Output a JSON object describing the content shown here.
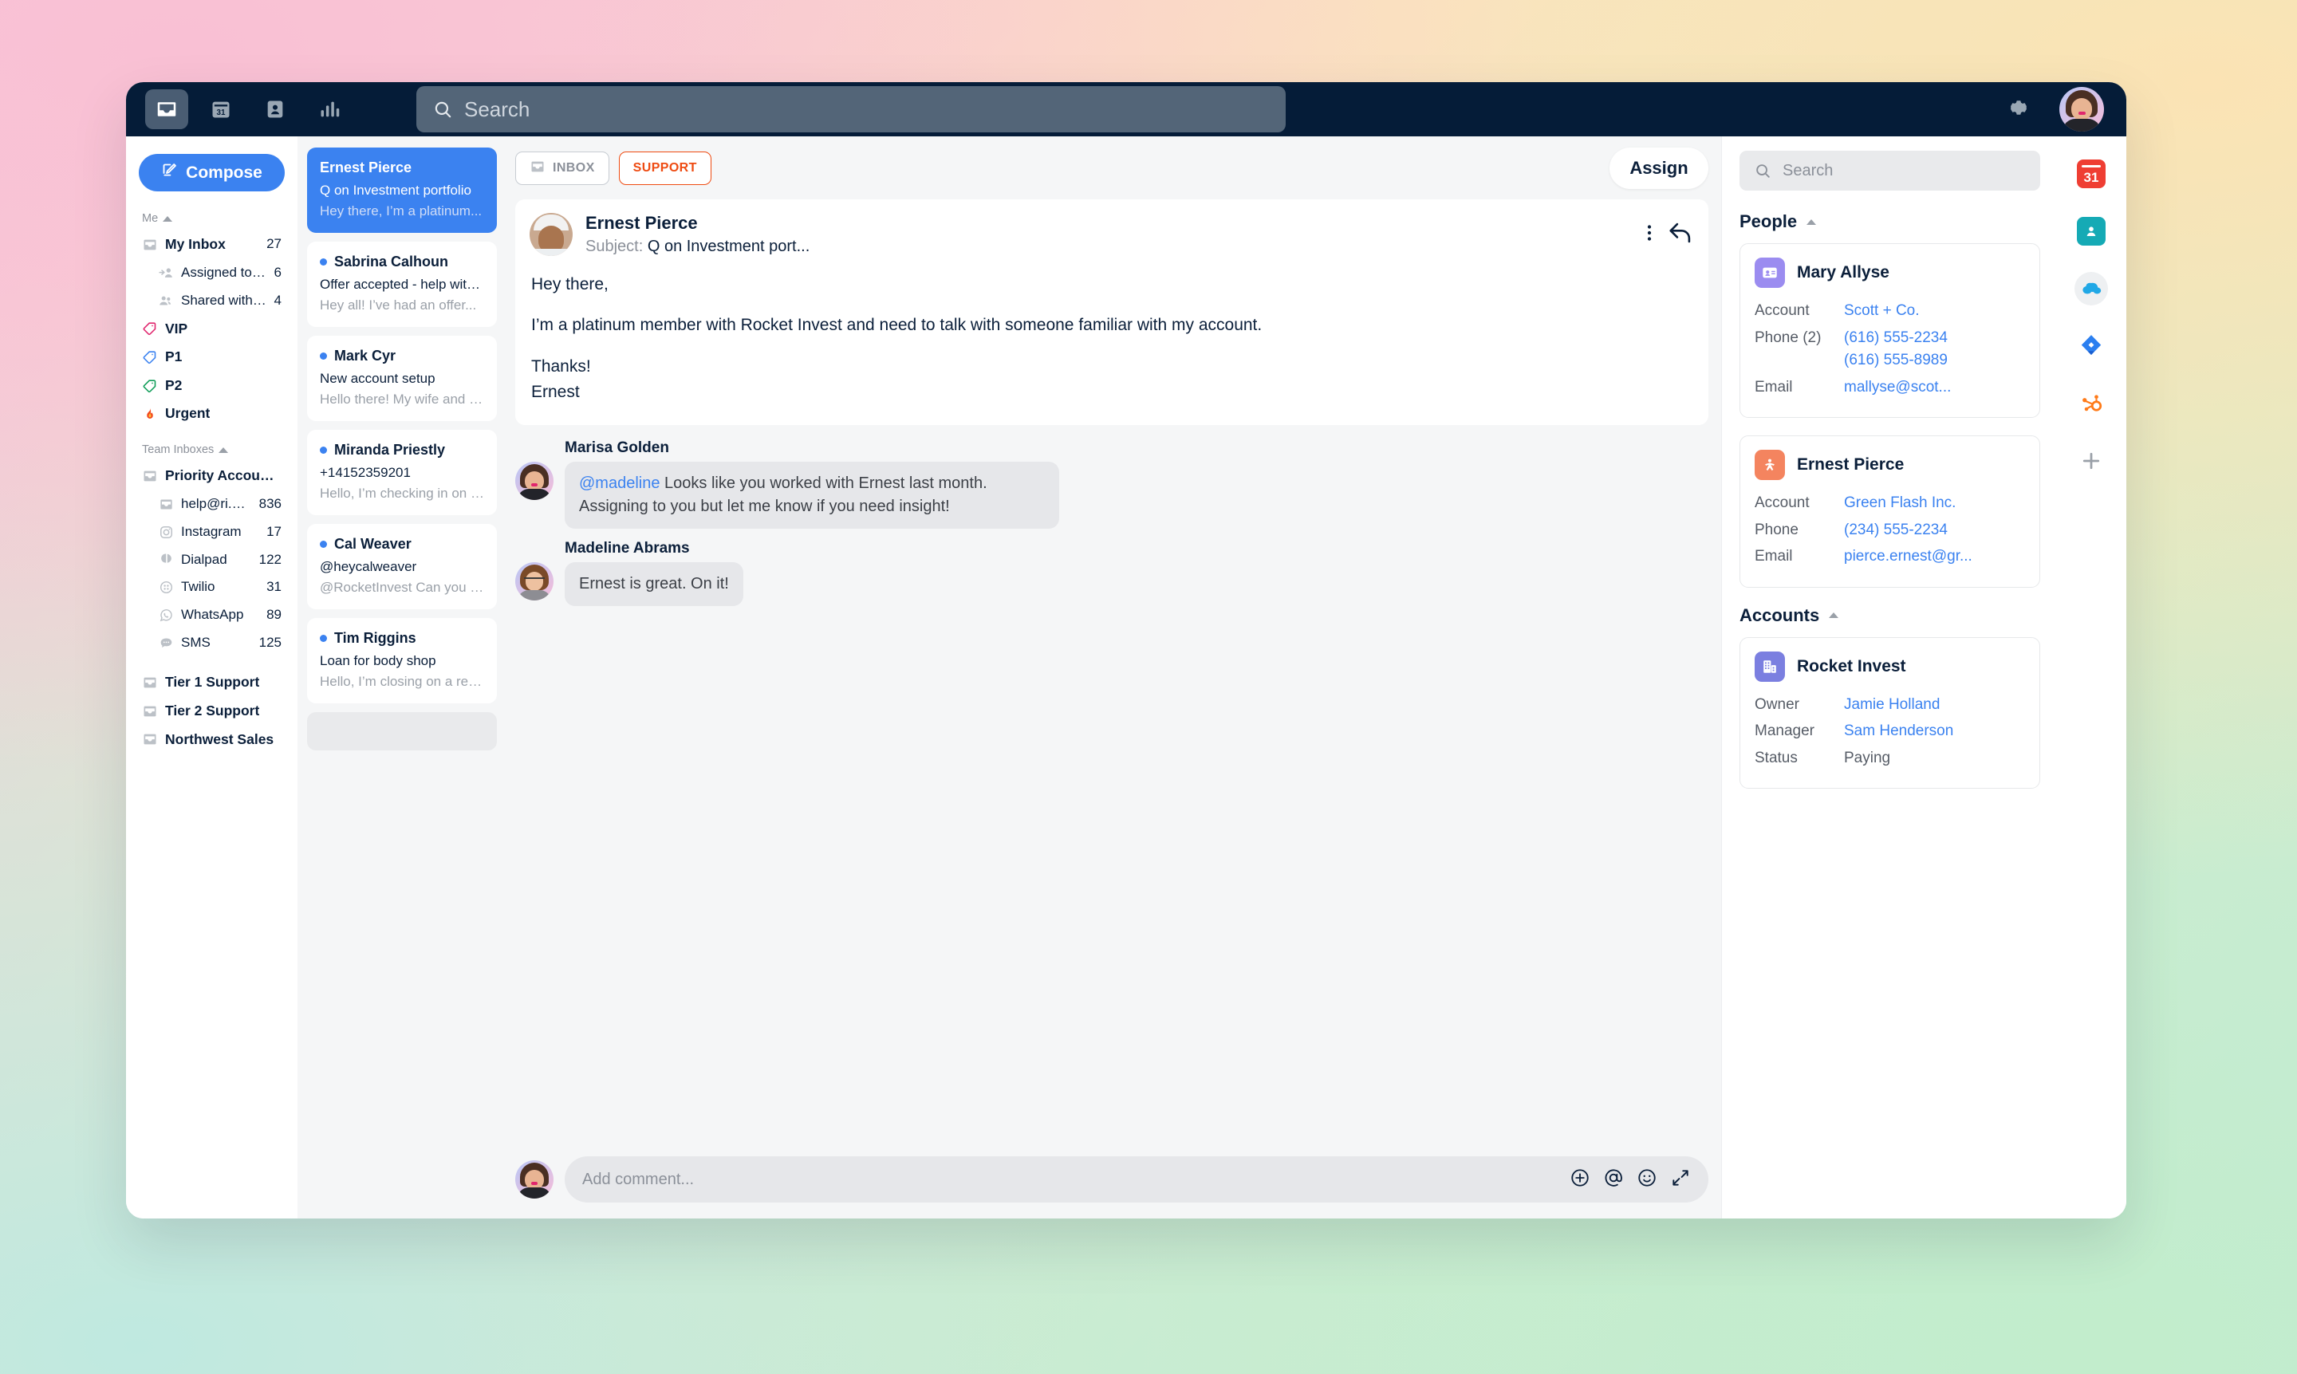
{
  "topbar": {
    "nav_icons": [
      "inbox-icon",
      "calendar-icon",
      "contacts-icon",
      "analytics-icon"
    ],
    "search_placeholder": "Search",
    "settings_label": "Settings",
    "avatar_label": "Account"
  },
  "sidebar": {
    "compose_label": "Compose",
    "groups": [
      {
        "title": "Me",
        "items": [
          {
            "icon": "inbox-icon",
            "label": "My Inbox",
            "count": "27",
            "bold": true,
            "indent": false
          },
          {
            "icon": "assigned-icon",
            "label": "Assigned to me",
            "count": "6",
            "bold": false,
            "indent": true
          },
          {
            "icon": "shared-icon",
            "label": "Shared with me",
            "count": "4",
            "bold": false,
            "indent": true
          },
          {
            "icon": "tag-pink-icon",
            "label": "VIP",
            "count": "",
            "bold": true,
            "indent": false
          },
          {
            "icon": "tag-blue-icon",
            "label": "P1",
            "count": "",
            "bold": true,
            "indent": false
          },
          {
            "icon": "tag-green-icon",
            "label": "P2",
            "count": "",
            "bold": true,
            "indent": false
          },
          {
            "icon": "fire-icon",
            "label": "Urgent",
            "count": "",
            "bold": true,
            "indent": false
          }
        ]
      },
      {
        "title": "Team Inboxes",
        "items": [
          {
            "icon": "inbox-icon",
            "label": "Priority Accounts",
            "count": "",
            "bold": true,
            "indent": false
          },
          {
            "icon": "inbox-icon",
            "label": "help@ri.com",
            "count": "836",
            "bold": false,
            "indent": true
          },
          {
            "icon": "instagram-icon",
            "label": "Instagram",
            "count": "17",
            "bold": false,
            "indent": true
          },
          {
            "icon": "dialpad-icon",
            "label": "Dialpad",
            "count": "122",
            "bold": false,
            "indent": true
          },
          {
            "icon": "twilio-icon",
            "label": "Twilio",
            "count": "31",
            "bold": false,
            "indent": true
          },
          {
            "icon": "whatsapp-icon",
            "label": "WhatsApp",
            "count": "89",
            "bold": false,
            "indent": true
          },
          {
            "icon": "sms-icon",
            "label": "SMS",
            "count": "125",
            "bold": false,
            "indent": true
          }
        ]
      },
      {
        "title": "",
        "items": [
          {
            "icon": "inbox-icon",
            "label": "Tier 1 Support",
            "count": "",
            "bold": true,
            "indent": false
          },
          {
            "icon": "inbox-icon",
            "label": "Tier 2 Support",
            "count": "",
            "bold": true,
            "indent": false
          },
          {
            "icon": "inbox-icon",
            "label": "Northwest Sales",
            "count": "",
            "bold": true,
            "indent": false
          }
        ]
      }
    ]
  },
  "conversations": [
    {
      "name": "Ernest Pierce",
      "subject": "Q on Investment portfolio",
      "preview": "Hey there, I’m a platinum...",
      "selected": true,
      "unread": false
    },
    {
      "name": "Sabrina Calhoun",
      "subject": "Offer accepted - help with wire",
      "preview": "Hey all! I’ve had an offer...",
      "selected": false,
      "unread": true
    },
    {
      "name": "Mark Cyr",
      "subject": "New account setup",
      "preview": "Hello there! My wife and I are...",
      "selected": false,
      "unread": true
    },
    {
      "name": "Miranda Priestly",
      "subject": "+14152359201",
      "preview": "Hello, I’m checking in on the...",
      "selected": false,
      "unread": true
    },
    {
      "name": "Cal Weaver",
      "subject": "@heycalweaver",
      "preview": "@RocketInvest Can you pleas...",
      "selected": false,
      "unread": true
    },
    {
      "name": "Tim Riggins",
      "subject": "Loan for body shop",
      "preview": "Hello, I’m closing on a rental...",
      "selected": false,
      "unread": true
    }
  ],
  "center": {
    "tab_inbox": "INBOX",
    "tab_support": "SUPPORT",
    "assign_label": "Assign",
    "message": {
      "sender": "Ernest Pierce",
      "subject_label": "Subject:",
      "subject": "Q on Investment port...",
      "paragraphs": [
        "Hey there,",
        "I’m a platinum member with Rocket Invest and need to talk with someone familiar with my account.",
        "Thanks!\nErnest"
      ]
    },
    "comments": [
      {
        "author": "Marisa Golden",
        "mention": "@madeline",
        "text": " Looks like you worked with Ernest last month. Assigning to you but let me know if you need insight!"
      },
      {
        "author": "Madeline Abrams",
        "mention": "",
        "text": "Ernest is great. On it!"
      }
    ],
    "composer_placeholder": "Add comment...",
    "composer_icons": [
      "plus-circle-icon",
      "mention-icon",
      "emoji-icon",
      "expand-icon"
    ]
  },
  "rightpanel": {
    "search_placeholder": "Search",
    "sections": [
      {
        "title": "People",
        "cards": [
          {
            "name": "Mary Allyse",
            "icon": "contact-card-icon",
            "icon_color": "#9b8cf0",
            "fields": [
              {
                "key": "Account",
                "value": "Scott + Co.",
                "value2": "",
                "link": true
              },
              {
                "key": "Phone (2)",
                "value": "(616) 555-2234",
                "value2": "(616) 555-8989",
                "link": true
              },
              {
                "key": "Email",
                "value": "mallyse@scot...",
                "value2": "",
                "link": true
              }
            ]
          },
          {
            "name": "Ernest Pierce",
            "icon": "person-star-icon",
            "icon_color": "#f4845f",
            "fields": [
              {
                "key": "Account",
                "value": "Green Flash Inc.",
                "value2": "",
                "link": true
              },
              {
                "key": "Phone",
                "value": "(234) 555-2234",
                "value2": "",
                "link": true
              },
              {
                "key": "Email",
                "value": "pierce.ernest@gr...",
                "value2": "",
                "link": true
              }
            ]
          }
        ]
      },
      {
        "title": "Accounts",
        "cards": [
          {
            "name": "Rocket Invest",
            "icon": "building-icon",
            "icon_color": "#7b7fe0",
            "fields": [
              {
                "key": "Owner",
                "value": "Jamie Holland",
                "value2": "",
                "link": true
              },
              {
                "key": "Manager",
                "value": "Sam Henderson",
                "value2": "",
                "link": true
              },
              {
                "key": "Status",
                "value": "Paying",
                "value2": "",
                "link": false
              }
            ]
          }
        ]
      }
    ]
  },
  "rail": {
    "items": [
      "calendar-31-icon",
      "contacts-teal-icon",
      "salesforce-icon",
      "jira-icon",
      "hubspot-icon",
      "add-integration-icon"
    ],
    "calendar_day": "31"
  },
  "colors": {
    "accent_blue": "#3b82f0",
    "topbar_navy": "#051c38",
    "support_orange": "#ee4b12",
    "text_navy": "#0b1f3a",
    "muted_gray": "#8b9099"
  }
}
